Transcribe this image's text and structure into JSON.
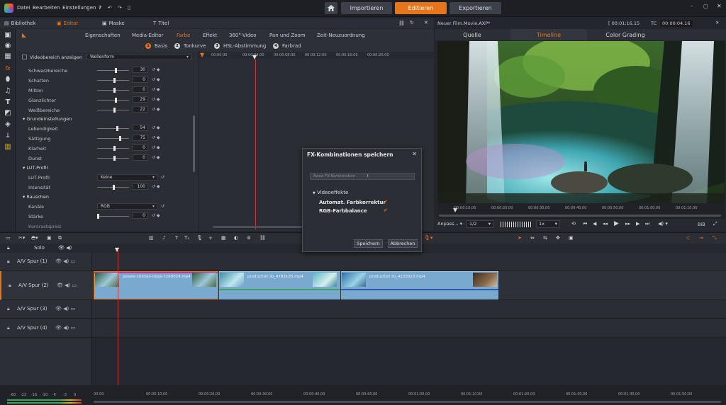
{
  "menubar": {
    "items": [
      "Datei",
      "Bearbeiten",
      "Einstellungen"
    ],
    "home": "home",
    "import": "Importieren",
    "edit": "Editieren",
    "export": "Exportieren"
  },
  "tabs": {
    "bibliothek": "Bibliothek",
    "editor": "Editor",
    "maske": "Maske",
    "titel": "Titel"
  },
  "editor": {
    "subtabs": [
      "Eigenschaften",
      "Media-Editor",
      "Farbe",
      "Effekt",
      "360°-Video",
      "Pan und Zoom",
      "Zeit-Neuzuordnung"
    ],
    "active_subtab": "Farbe",
    "radios": [
      {
        "num": "1",
        "label": "Basis"
      },
      {
        "num": "2",
        "label": "Tonkurve"
      },
      {
        "num": "3",
        "label": "HSL-Abstimmung"
      },
      {
        "num": "4",
        "label": "Farbrad"
      }
    ],
    "videobereich_label": "Videobereich anzeigen",
    "videobereich_value": "Wellenform",
    "params_top": [
      {
        "label": "Schwarzbereiche",
        "value": "30",
        "pos": 0.55
      },
      {
        "label": "Schatten",
        "value": "0",
        "pos": 0.5
      },
      {
        "label": "Mitten",
        "value": "0",
        "pos": 0.5
      },
      {
        "label": "Glanzlichter",
        "value": "29",
        "pos": 0.55
      },
      {
        "label": "Weißbereiche",
        "value": "22",
        "pos": 0.52
      }
    ],
    "section_grund": "Grundeinstellungen",
    "params_grund": [
      {
        "label": "Lebendigkeit",
        "value": "54",
        "pos": 0.6
      },
      {
        "label": "Sättigung",
        "value": "75",
        "pos": 0.7
      },
      {
        "label": "Klarheit",
        "value": "0",
        "pos": 0.5
      },
      {
        "label": "Dunst",
        "value": "0",
        "pos": 0.5
      }
    ],
    "section_lut": "LUT-Profil",
    "lut_label": "LUT-Profil",
    "lut_value": "Keine",
    "intensitaet_label": "Intensität",
    "intensitaet_value": "100",
    "section_rauschen": "Rauschen",
    "kanaele_label": "Kanäle",
    "kanaele_value": "RGB",
    "staerke_label": "Stärke",
    "staerke_value": "0",
    "partial_label": "Kontrastspreiz",
    "kf_ticks": [
      "00:00:00",
      "00:00:04:00",
      "00:00:08:00",
      "00:00:12:00",
      "00:00:16:00",
      "00:00:20:00"
    ]
  },
  "preview": {
    "filename": "Neuer Film.Movie.AXP*",
    "timecode": "[ 00:01:16.15",
    "tc_label": "TC",
    "tc_value": "00:00:04.16",
    "tabs": [
      "Quelle",
      "Timeline",
      "Color Grading"
    ],
    "active_tab": "Timeline",
    "ruler": [
      "00:00:10,00",
      "00:00:20,00",
      "00:00:30,00",
      "00:00:40,00",
      "00:00:50,00",
      "00:01:00,00",
      "00:01:10,00"
    ],
    "fit": "Anpass...",
    "ratio": "1/2",
    "speed": "1x",
    "bib": "BiB"
  },
  "timeline": {
    "solo": "Solo",
    "tracks": [
      {
        "name": "A/V Spur (1)"
      },
      {
        "name": "A/V Spur (2)"
      },
      {
        "name": "A/V Spur (3)"
      },
      {
        "name": "A/V Spur (4)"
      }
    ],
    "clips": [
      {
        "name": "pexels-cristian-rojas-7290024.mp4"
      },
      {
        "name": "production ID_4782135.mp4"
      },
      {
        "name": "production ID_4133023.mp4"
      }
    ],
    "ruler": [
      "00:00",
      "00:00:10,00",
      "00:00:20,00",
      "00:00:30,00",
      "00:00:40,00",
      "00:00:50,00",
      "00:01:00,00",
      "00:01:10,00",
      "00:01:20,00",
      "00:01:30,00",
      "00:01:40,00",
      "00:01:50,00"
    ],
    "meter": [
      "-60",
      "-22",
      "-16",
      "-10",
      "-6",
      "-3",
      "0"
    ]
  },
  "dialog": {
    "title": "FX-Kombinationen speichern",
    "placeholder": "Neue FX-Kombination",
    "group": "Videoeffekte",
    "items": [
      "Automat. Farbkorrektur",
      "RGB-Farbbalance"
    ],
    "save": "Speichern",
    "cancel": "Abbrechen"
  },
  "colors": {
    "accent": "#e8751a",
    "clip": "#7aa9cf",
    "playhead": "#c23b3b"
  }
}
